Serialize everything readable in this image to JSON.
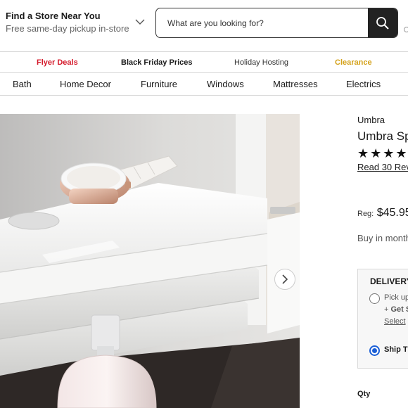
{
  "header": {
    "store_title": "Find a Store Near You",
    "store_subtitle": "Free same-day pickup in-store",
    "search_placeholder": "What are you looking for?"
  },
  "promo_links": [
    "Flyer Deals",
    "Black Friday Prices",
    "Holiday Hosting",
    "Clearance"
  ],
  "categories": [
    "Bath",
    "Home Decor",
    "Furniture",
    "Windows",
    "Mattresses",
    "Electrics"
  ],
  "product": {
    "brand": "Umbra",
    "title": "Umbra Sp",
    "rating_stars": 4,
    "reviews_link": "Read 30 Rev",
    "price_label": "Reg:",
    "price": "$45.95",
    "monthly_text": "Buy in month",
    "delivery": {
      "title": "DELIVERY",
      "pickup_line1": "Pick up",
      "pickup_line2_prefix": "+ ",
      "pickup_line2_bold": "Get S",
      "pickup_link": "Select",
      "ship_label": "Ship T"
    },
    "qty_label": "Qty"
  },
  "colors": {
    "flyer": "#d4192a",
    "clearance": "#d4a21b",
    "radio_checked": "#1b5fd6",
    "search_button": "#222222"
  }
}
